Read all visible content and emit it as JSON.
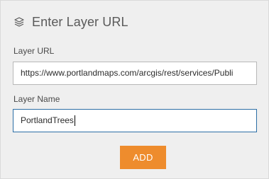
{
  "header": {
    "icon": "layers-icon",
    "title": "Enter Layer URL"
  },
  "layer_url": {
    "label": "Layer URL",
    "value": "https://www.portlandmaps.com/arcgis/rest/services/Publi"
  },
  "layer_name": {
    "label": "Layer Name",
    "value": "PortlandTrees"
  },
  "actions": {
    "add_label": "ADD"
  },
  "colors": {
    "panel_bg": "#efefef",
    "accent": "#ee8c2d",
    "focus_border": "#2b6ea5"
  }
}
